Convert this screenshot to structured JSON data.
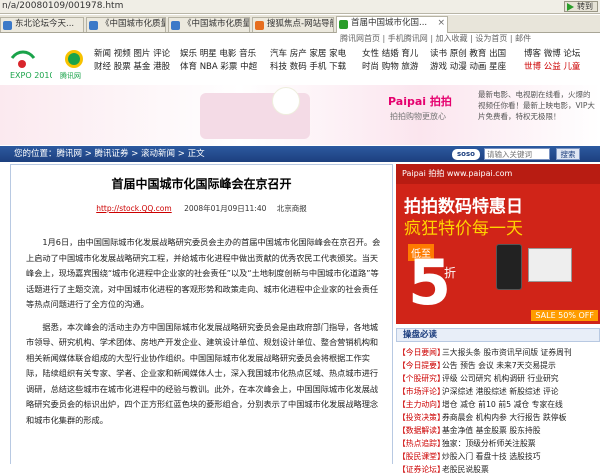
{
  "address_bar": {
    "url": "n/a/20080109/001978.htm",
    "go_label": "转到"
  },
  "tabs": [
    {
      "label": "东北论坛今天..."
    },
    {
      "label": "《中国城市化质量评..."
    },
    {
      "label": "《中国城市化质量评..."
    },
    {
      "label": "搜狐焦点-网站导航"
    },
    {
      "label": "首届中国城市化国..."
    }
  ],
  "header": {
    "top_links": "腾讯网首页 | 手机腾讯网 | 加入收藏 | 设为首页 | 邮件",
    "logo_text": "EXPO 2010",
    "qq_logo": "腾讯网",
    "nav_groups": [
      {
        "items": [
          "新闻 视频 图片 评论",
          "财经 股票 基金 港股"
        ]
      },
      {
        "items": [
          "娱乐 明星 电影 音乐",
          "体育 NBA 彩票 中超"
        ]
      },
      {
        "items": [
          "汽车 房产 家居 家电",
          "科技 数码 手机 下载"
        ]
      },
      {
        "items": [
          "女性 结婚 育儿",
          "时尚 购物 旅游"
        ]
      },
      {
        "items": [
          "读书 原创 教育 出国",
          "游戏 动漫 动画 星座"
        ]
      },
      {
        "items": [
          "博客 微博 论坛",
          "世博 公益 儿童"
        ]
      }
    ]
  },
  "banner": {
    "paipai_label": "Paipai 拍拍",
    "paipai_sub": "拍拍购物更放心",
    "right_text": "最新电影、电视剧在线看，火爆的视频任你看！最新上映电影，VIP大片免费看，特权无极限！"
  },
  "breadcrumb": {
    "path": "您的位置：腾讯网 > 腾讯证券 > 滚动新闻 > 正文",
    "search_placeholder": "请输入关键词",
    "search_button": "搜索"
  },
  "article": {
    "title": "首届中国城市化国际峰会在京召开",
    "source_link": "http://stock.QQ.com",
    "datetime": "2008年01月09日11:40",
    "publisher": "北京商报",
    "paragraphs": [
      "1月6日，由中国国际城市化发展战略研究委员会主办的首届中国城市化国际峰会在京召开。会上启动了中国城市化发展战略研究工程，并给城市化进程中做出贡献的优秀农民工代表颁奖。当天峰会上，现场嘉宾围绕“城市化进程中企业家的社会责任”以及“土地制度创新与中国城市化道路”等话题进行了主题交流，对中国城市化进程的客观形势和政策走向、城市化进程中企业家的社会责任等热点问题进行了全方位的沟通。",
      "据悉，本次峰会的活动主办方中国国际城市化发展战略研究委员会是由政府部门指导，各地城市领导、研究机构、学术团体、房地产开发企业、建筑设计单位、规划设计单位、整合营销机构和相关新闻媒体联合组成的大型行业协作组织。中国国际城市化发展战略研究委员会将根据工作实际，陆续组织有关专家、学者、企业家和新闻媒体人士，深入我国城市化热点区域、热点城市进行调研，总结这些城市在城市化进程中的经验与教训。此外，在本次峰会上，中国国际城市化发展战略研究委员会的标识出炉，四个正方形红蓝色块的菱形组合，分别表示了中国城市化发展战略理念和城市化集群的形成。"
    ]
  },
  "sidebar": {
    "ad": {
      "brand": "Paipai 拍拍 www.paipai.com",
      "line1": "拍拍数码特惠日",
      "line2": "疯狂特价每一天",
      "low": "低至",
      "five": "5",
      "zhe": "折",
      "sale": "SALE 50% OFF"
    },
    "must_read_title": "操盘必读",
    "must_read": [
      {
        "label": "【今日要闻】",
        "text": "三大报头条 股市资讯早间版 证券周刊"
      },
      {
        "label": "【今日提要】",
        "text": "公告 预告 会议 未来7天交易提示"
      },
      {
        "label": "【个股研究】",
        "text": "评级 公司研究 机构调研 行业研究"
      },
      {
        "label": "【市场评论】",
        "text": "沪深综述 港股综述 新股综述 评论"
      },
      {
        "label": "【主力动向】",
        "text": "增仓 减仓 前10 前5 减仓 专家在线"
      },
      {
        "label": "【投资决策】",
        "text": "券商晨会 机构内参 大行报告 跌停板"
      },
      {
        "label": "【数据解读】",
        "text": "基金净值 基金股票 股东持股"
      },
      {
        "label": "【热点追踪】",
        "text": "独家：顶级分析师关注股票"
      },
      {
        "label": "【股民课堂】",
        "text": "炒股入门 看盘十技 选股技巧"
      },
      {
        "label": "【证券论坛】",
        "text": "老股民说股票"
      }
    ]
  }
}
